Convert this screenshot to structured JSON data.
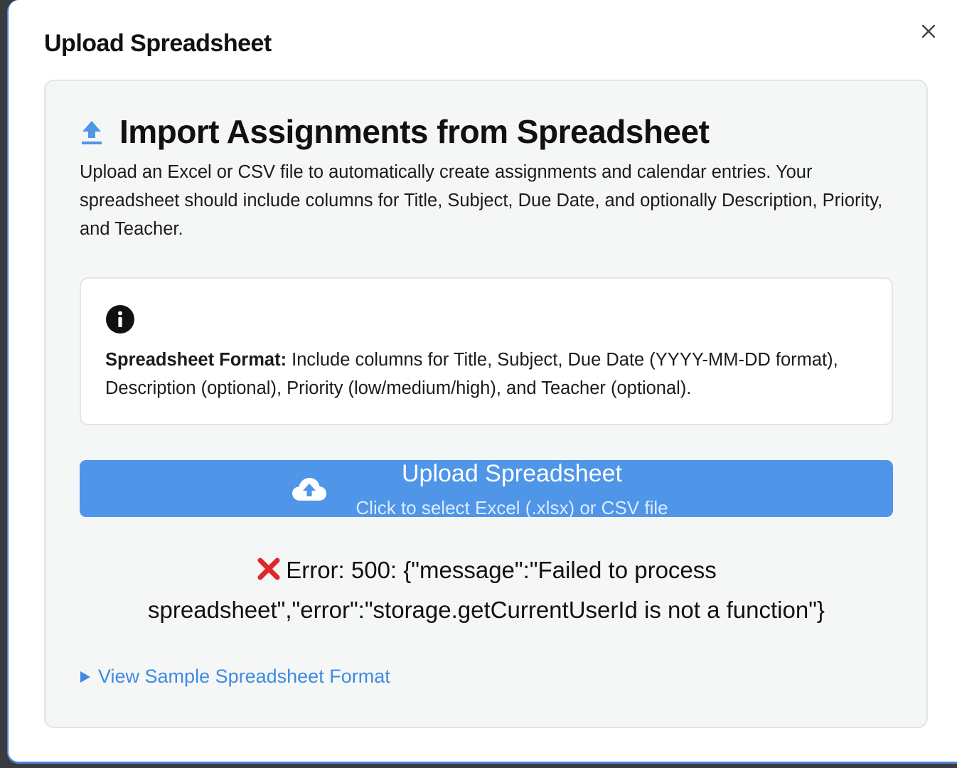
{
  "modal": {
    "title": "Upload Spreadsheet",
    "close_icon": "close-icon"
  },
  "card": {
    "icon": "upload-icon",
    "title": "Import Assignments from Spreadsheet",
    "description": "Upload an Excel or CSV file to automatically create assignments and calendar entries. Your spreadsheet should include columns for Title, Subject, Due Date, and optionally Description, Priority, and Teacher."
  },
  "info": {
    "icon": "info-icon",
    "label": "Spreadsheet Format:",
    "text": " Include columns for Title, Subject, Due Date (YYYY-MM-DD format), Description (optional), Priority (low/medium/high), and Teacher (optional)."
  },
  "upload_button": {
    "icon": "cloud-upload-icon",
    "label": "Upload Spreadsheet",
    "sublabel": "Click to select Excel (.xlsx) or CSV file"
  },
  "error": {
    "icon": "cross-mark-icon",
    "message": "Error: 500: {\"message\":\"Failed to process spreadsheet\",\"error\":\"storage.getCurrentUserId is not a function\"}"
  },
  "sample_link": {
    "icon": "triangle-right-icon",
    "label": "View Sample Spreadsheet Format"
  },
  "colors": {
    "accent": "#4f95e8",
    "link": "#3f8ae2",
    "error": "#e0282a",
    "card_bg": "#f5f7f7"
  }
}
